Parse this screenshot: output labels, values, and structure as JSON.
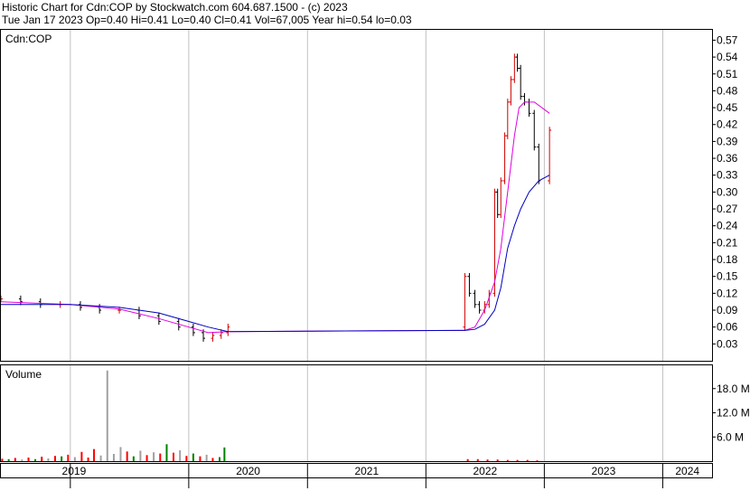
{
  "header": {
    "title": "Historic Chart for Cdn:COP by Stockwatch.com 604.687.1500 - (c) 2023",
    "quote": "Tue Jan 17 2023  Op=0.40  Hi=0.41  Lo=0.40  Cl=0.41  Vol=67,005  Year hi=0.54  lo=0.03"
  },
  "colors": {
    "price_up": "#d00000",
    "price_down": "#000000",
    "ma_short": "#e000e0",
    "ma_long": "#0000c0",
    "volume_up": "#ff0000",
    "volume_down": "#008000",
    "volume_neutral": "#a0a0a0",
    "grid": "#c0c0c0"
  },
  "chart_data": [
    {
      "type": "line",
      "panel": "price",
      "symbol_label": "Cdn:COP",
      "y_ticks": [
        "0.57",
        "0.54",
        "0.51",
        "0.48",
        "0.45",
        "0.42",
        "0.39",
        "0.36",
        "0.33",
        "0.30",
        "0.27",
        "0.24",
        "0.21",
        "0.18",
        "0.15",
        "0.12",
        "0.09",
        "0.06",
        "0.03"
      ],
      "ylim": [
        0.0,
        0.59
      ],
      "x_labels": [
        "2019",
        "2020",
        "2021",
        "2022",
        "2023",
        "2024"
      ],
      "xlim": [
        "2018-06-01",
        "2024-06-01"
      ],
      "series": [
        {
          "key": "price",
          "points": [
            [
              "2018-06-01",
              0.11
            ],
            [
              "2018-08-01",
              0.105
            ],
            [
              "2018-10-01",
              0.1
            ],
            [
              "2018-12-01",
              0.1
            ],
            [
              "2019-02-01",
              0.095
            ],
            [
              "2019-04-01",
              0.09
            ],
            [
              "2019-06-01",
              0.09
            ],
            [
              "2019-08-01",
              0.08
            ],
            [
              "2019-10-01",
              0.07
            ],
            [
              "2019-12-01",
              0.06
            ],
            [
              "2020-01-15",
              0.05
            ],
            [
              "2020-02-15",
              0.04
            ],
            [
              "2020-03-15",
              0.045
            ],
            [
              "2020-04-10",
              0.05
            ],
            [
              "2020-05-01",
              0.06
            ],
            [
              "2022-05-01",
              0.15
            ],
            [
              "2022-05-15",
              0.12
            ],
            [
              "2022-06-01",
              0.1
            ],
            [
              "2022-06-15",
              0.09
            ],
            [
              "2022-07-01",
              0.1
            ],
            [
              "2022-07-15",
              0.12
            ],
            [
              "2022-08-01",
              0.3
            ],
            [
              "2022-08-10",
              0.26
            ],
            [
              "2022-08-20",
              0.32
            ],
            [
              "2022-09-01",
              0.4
            ],
            [
              "2022-09-10",
              0.46
            ],
            [
              "2022-09-20",
              0.5
            ],
            [
              "2022-10-01",
              0.54
            ],
            [
              "2022-10-10",
              0.52
            ],
            [
              "2022-10-20",
              0.47
            ],
            [
              "2022-11-01",
              0.46
            ],
            [
              "2022-11-15",
              0.44
            ],
            [
              "2022-12-01",
              0.38
            ],
            [
              "2022-12-15",
              0.32
            ],
            [
              "2023-01-17",
              0.41
            ]
          ]
        },
        {
          "key": "ma_short",
          "points": [
            [
              "2018-06-01",
              0.105
            ],
            [
              "2019-01-01",
              0.1
            ],
            [
              "2019-06-01",
              0.092
            ],
            [
              "2019-10-01",
              0.075
            ],
            [
              "2020-01-01",
              0.06
            ],
            [
              "2020-03-01",
              0.05
            ],
            [
              "2020-05-01",
              0.052
            ],
            [
              "2022-05-01",
              0.054
            ],
            [
              "2022-06-01",
              0.06
            ],
            [
              "2022-07-01",
              0.09
            ],
            [
              "2022-08-01",
              0.14
            ],
            [
              "2022-08-20",
              0.2
            ],
            [
              "2022-09-10",
              0.3
            ],
            [
              "2022-10-01",
              0.4
            ],
            [
              "2022-10-15",
              0.45
            ],
            [
              "2022-11-01",
              0.46
            ],
            [
              "2022-12-01",
              0.46
            ],
            [
              "2023-01-17",
              0.44
            ]
          ]
        },
        {
          "key": "ma_long",
          "points": [
            [
              "2018-06-01",
              0.1
            ],
            [
              "2019-01-01",
              0.1
            ],
            [
              "2019-06-01",
              0.095
            ],
            [
              "2019-10-01",
              0.085
            ],
            [
              "2020-01-01",
              0.07
            ],
            [
              "2020-03-01",
              0.06
            ],
            [
              "2020-05-01",
              0.052
            ],
            [
              "2022-05-01",
              0.054
            ],
            [
              "2022-06-01",
              0.056
            ],
            [
              "2022-07-01",
              0.065
            ],
            [
              "2022-08-01",
              0.09
            ],
            [
              "2022-08-20",
              0.13
            ],
            [
              "2022-09-10",
              0.2
            ],
            [
              "2022-10-01",
              0.24
            ],
            [
              "2022-10-20",
              0.27
            ],
            [
              "2022-11-15",
              0.3
            ],
            [
              "2022-12-15",
              0.32
            ],
            [
              "2023-01-17",
              0.33
            ]
          ]
        }
      ]
    },
    {
      "type": "bar",
      "panel": "volume",
      "title": "Volume",
      "y_ticks": [
        "18.0 M",
        "12.0 M",
        "6.0 M"
      ],
      "ylim": [
        0,
        24
      ],
      "unit": "M",
      "bars": [
        [
          "2018-06-05",
          0.6,
          "up"
        ],
        [
          "2018-06-25",
          0.5,
          "down"
        ],
        [
          "2018-07-15",
          0.8,
          "up"
        ],
        [
          "2018-08-05",
          0.4,
          "neutral"
        ],
        [
          "2018-08-25",
          0.9,
          "up"
        ],
        [
          "2018-09-15",
          0.5,
          "down"
        ],
        [
          "2018-10-05",
          1.1,
          "up"
        ],
        [
          "2018-10-25",
          0.7,
          "neutral"
        ],
        [
          "2018-11-15",
          1.3,
          "up"
        ],
        [
          "2018-12-05",
          1.2,
          "down"
        ],
        [
          "2018-12-25",
          1.6,
          "up"
        ],
        [
          "2019-01-15",
          1.0,
          "neutral"
        ],
        [
          "2019-02-05",
          2.3,
          "up"
        ],
        [
          "2019-02-25",
          0.9,
          "up"
        ],
        [
          "2019-03-15",
          3.0,
          "up"
        ],
        [
          "2019-04-05",
          1.4,
          "neutral"
        ],
        [
          "2019-04-25",
          22.5,
          "neutral"
        ],
        [
          "2019-05-15",
          1.8,
          "neutral"
        ],
        [
          "2019-06-05",
          3.5,
          "neutral"
        ],
        [
          "2019-06-25",
          2.4,
          "up"
        ],
        [
          "2019-07-15",
          1.2,
          "down"
        ],
        [
          "2019-08-05",
          2.6,
          "neutral"
        ],
        [
          "2019-08-25",
          1.5,
          "up"
        ],
        [
          "2019-09-15",
          2.2,
          "neutral"
        ],
        [
          "2019-10-05",
          1.9,
          "up"
        ],
        [
          "2019-10-25",
          4.2,
          "down"
        ],
        [
          "2019-11-15",
          2.1,
          "up"
        ],
        [
          "2019-12-05",
          2.7,
          "neutral"
        ],
        [
          "2019-12-25",
          1.3,
          "up"
        ],
        [
          "2020-01-15",
          1.9,
          "down"
        ],
        [
          "2020-02-05",
          1.2,
          "up"
        ],
        [
          "2020-02-25",
          1.6,
          "neutral"
        ],
        [
          "2020-03-15",
          0.8,
          "up"
        ],
        [
          "2020-04-05",
          1.0,
          "down"
        ],
        [
          "2020-04-20",
          3.4,
          "down"
        ],
        [
          "2022-05-10",
          0.5,
          "up"
        ],
        [
          "2022-06-10",
          0.5,
          "up"
        ],
        [
          "2022-07-10",
          0.4,
          "up"
        ],
        [
          "2022-08-10",
          0.4,
          "up"
        ],
        [
          "2022-09-10",
          0.3,
          "up"
        ],
        [
          "2022-10-10",
          0.3,
          "up"
        ],
        [
          "2022-11-10",
          0.3,
          "up"
        ],
        [
          "2022-12-10",
          0.2,
          "up"
        ]
      ]
    }
  ]
}
